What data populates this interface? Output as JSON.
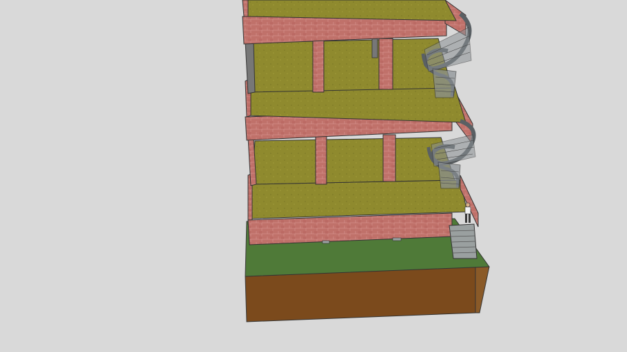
{
  "scene": {
    "background_color": "#d9d9d9",
    "colors": {
      "grass_floor": "#8f8a2e",
      "grass_floor_dark": "#7a7626",
      "ground_grass": "#4f7a38",
      "soil_front": "#7b4a1c",
      "soil_side": "#8a5a28",
      "brick": "#c0716a",
      "brick_dark": "#8a4a44",
      "mortar": "#d89890",
      "stair_metal": "#8a9094",
      "stair_dark": "#5a6064",
      "concrete_steps": "#9aa0a0",
      "outline": "#333333",
      "figure_shirt": "#f2f2f2",
      "figure_pants": "#3a3a3a"
    },
    "icons": {
      "spiral_stair_upper": "spiral-staircase-icon",
      "spiral_stair_lower": "spiral-staircase-icon",
      "entry_steps": "straight-stairs-icon",
      "person": "human-figure-icon"
    }
  }
}
